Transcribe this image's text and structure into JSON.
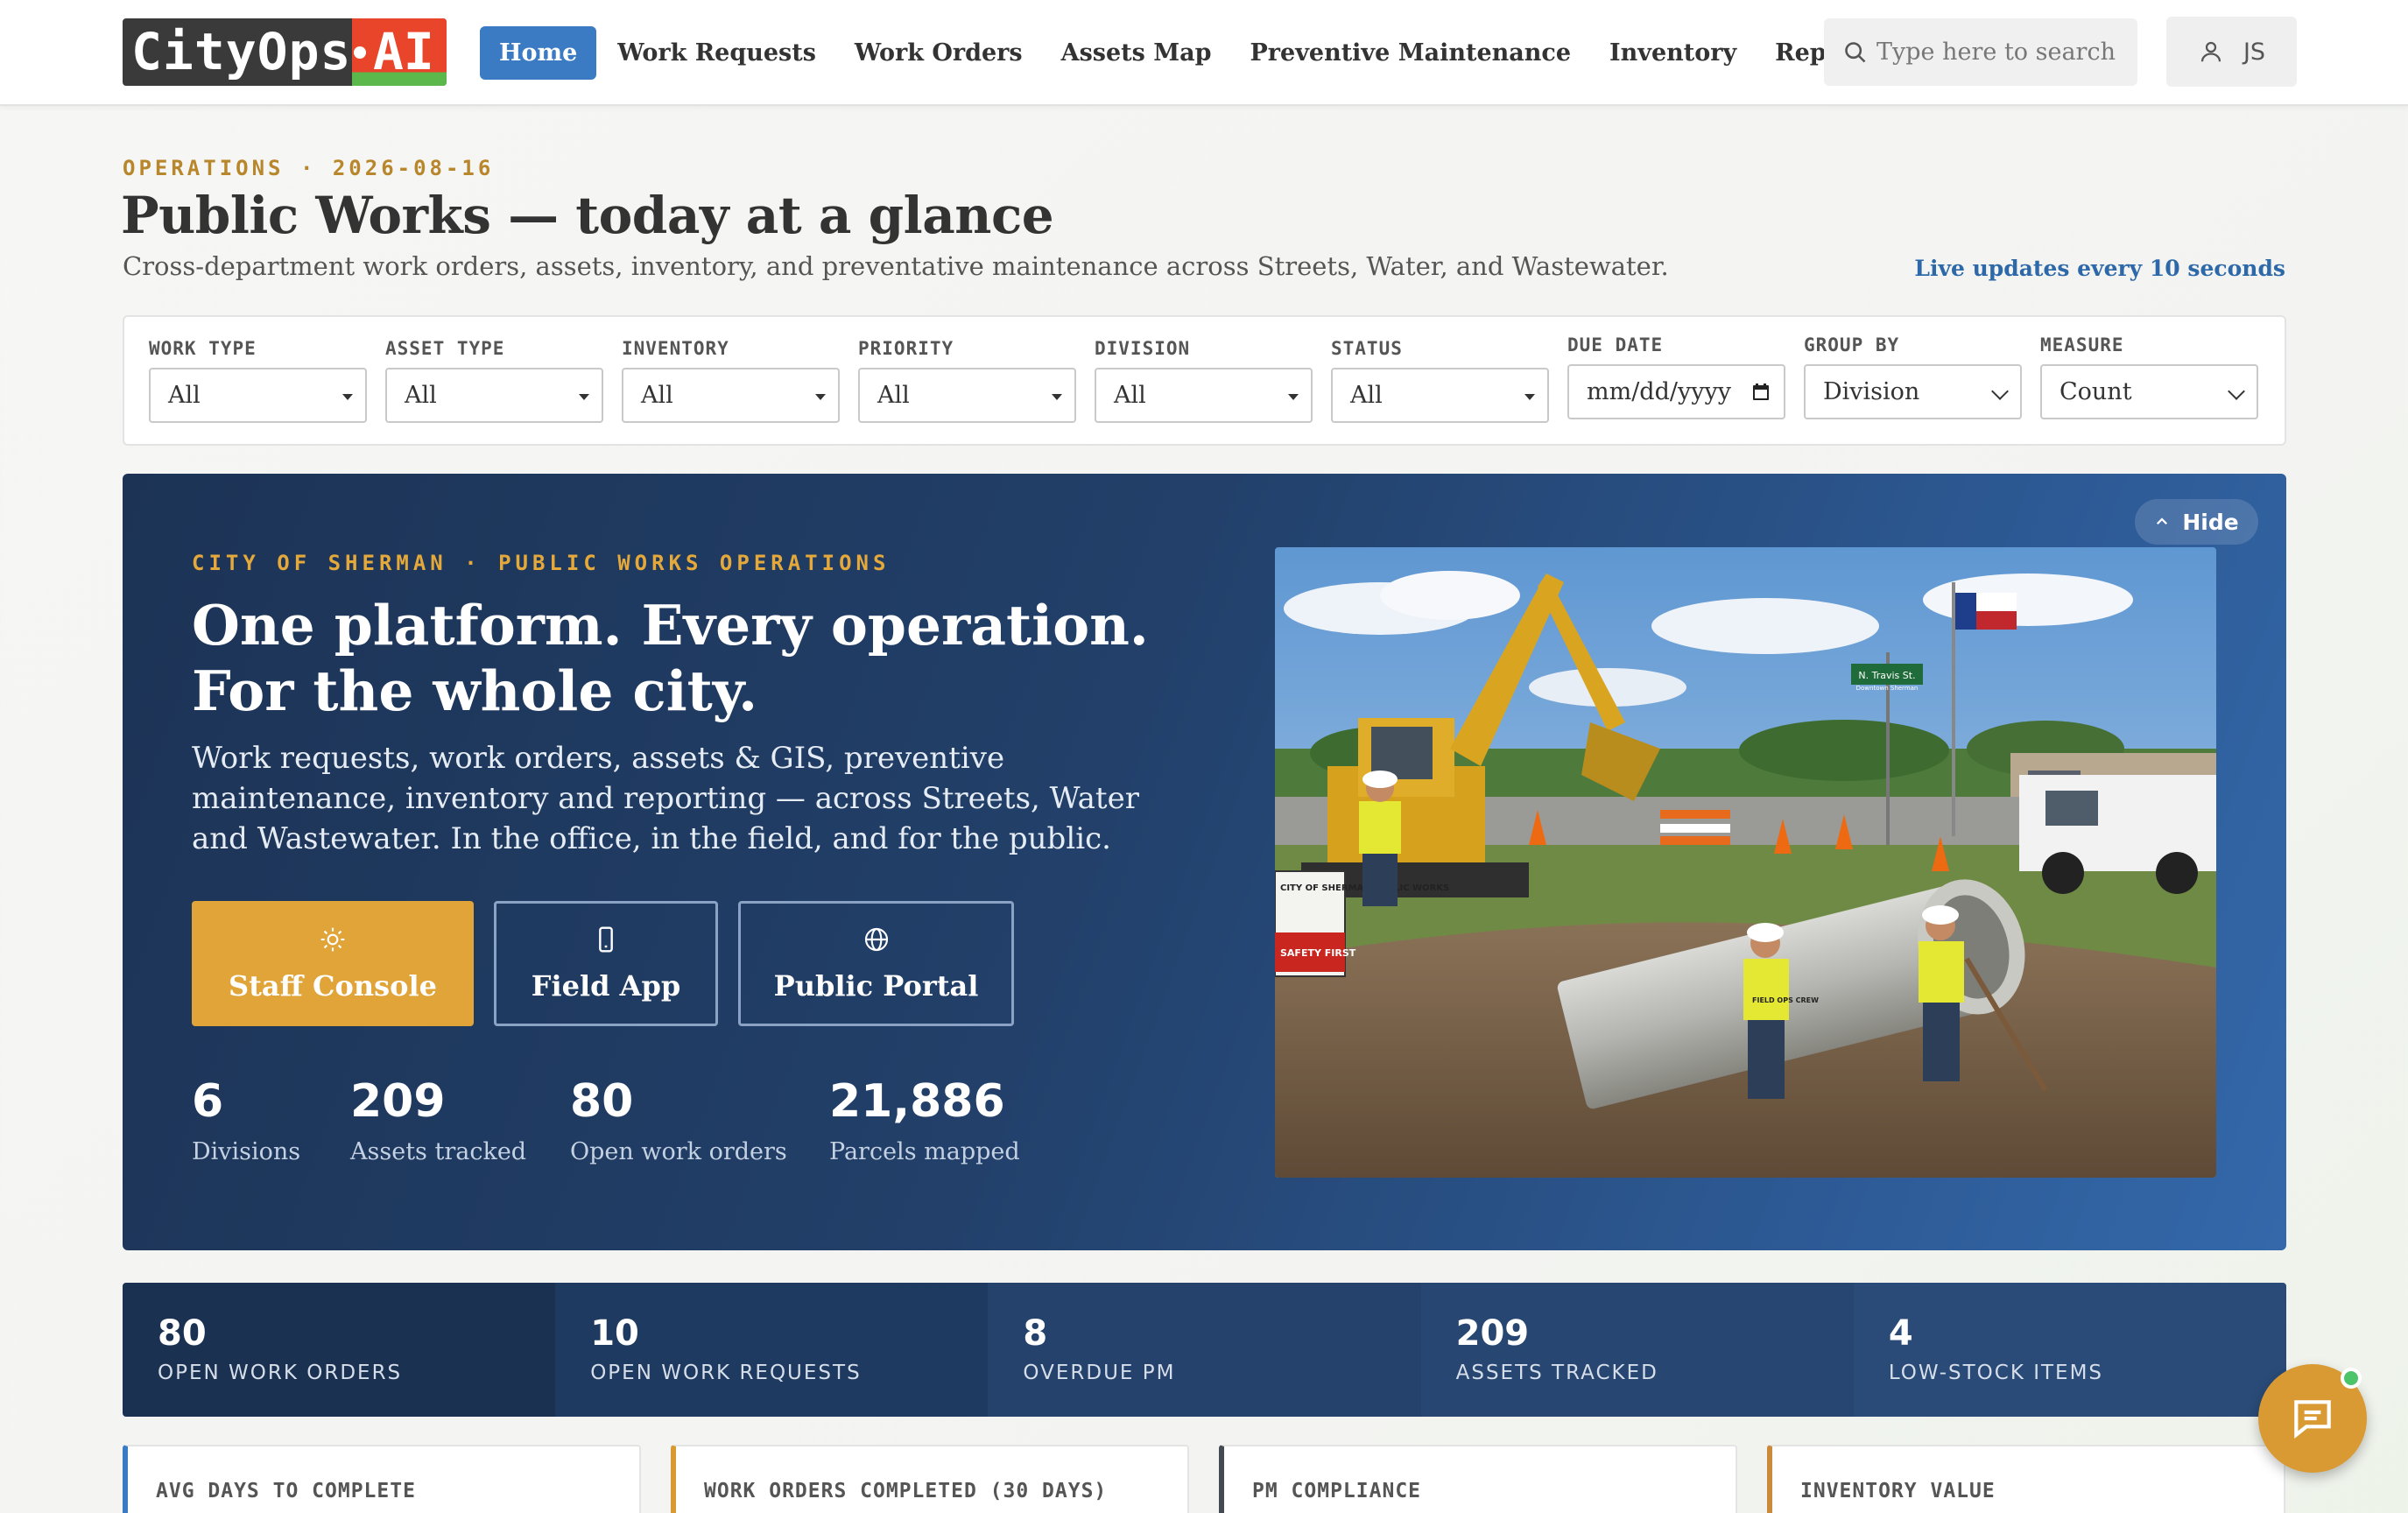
{
  "brand": {
    "name_part": "CityOps",
    "ai_part": "AI",
    "colors": {
      "primary": "#3a7bc4",
      "accent": "#e0a438",
      "navy": "#1c3355"
    }
  },
  "nav": {
    "items": [
      {
        "label": "Home",
        "active": true
      },
      {
        "label": "Work Requests",
        "active": false
      },
      {
        "label": "Work Orders",
        "active": false
      },
      {
        "label": "Assets Map",
        "active": false
      },
      {
        "label": "Preventive Maintenance",
        "active": false
      },
      {
        "label": "Inventory",
        "active": false
      },
      {
        "label": "Reports",
        "active": false
      }
    ]
  },
  "search": {
    "placeholder": "Type here to search",
    "icon": "search-icon"
  },
  "user": {
    "initials": "JS",
    "icon": "user-icon"
  },
  "header": {
    "eyebrow": "OPERATIONS · 2026-08-16",
    "title": "Public Works — today at a glance",
    "subtitle": "Cross-department work orders, assets, inventory, and preventative maintenance across Streets, Water, and Wastewater.",
    "live_note": "Live updates every 10 seconds"
  },
  "filters": [
    {
      "label": "WORK TYPE",
      "value": "All"
    },
    {
      "label": "ASSET TYPE",
      "value": "All"
    },
    {
      "label": "INVENTORY",
      "value": "All"
    },
    {
      "label": "PRIORITY",
      "value": "All"
    },
    {
      "label": "DIVISION",
      "value": "All"
    },
    {
      "label": "STATUS",
      "value": "All"
    },
    {
      "label": "DUE DATE",
      "value": "mm/dd/yyyy"
    },
    {
      "label": "GROUP BY",
      "value": "Division"
    },
    {
      "label": "MEASURE",
      "value": "Count"
    }
  ],
  "hero": {
    "kicker": "CITY OF SHERMAN · PUBLIC WORKS OPERATIONS",
    "title_line1": "One platform. Every operation.",
    "title_line2": "For the whole city.",
    "description": "Work requests, work orders, assets & GIS, preventive maintenance, inventory and reporting — across Streets, Water and Wastewater. In the office, in the field, and for the public.",
    "hide_label": "Hide",
    "buttons": [
      {
        "label": "Staff Console",
        "icon": "sun-icon"
      },
      {
        "label": "Field App",
        "icon": "phone-icon"
      },
      {
        "label": "Public Portal",
        "icon": "globe-icon"
      }
    ],
    "stats": [
      {
        "value": "6",
        "label": "Divisions"
      },
      {
        "value": "209",
        "label": "Assets tracked"
      },
      {
        "value": "80",
        "label": "Open work orders"
      },
      {
        "value": "21,886",
        "label": "Parcels mapped"
      }
    ],
    "photo": {
      "street_sign": "N. Travis St.",
      "street_sign_sub": "Downtown Sherman",
      "board_text": "CITY OF SHERMAN PUBLIC WORKS",
      "safety_text": "SAFETY FIRST",
      "vest_text": "FIELD OPS CREW"
    }
  },
  "kpis": [
    {
      "value": "80",
      "label": "OPEN WORK ORDERS",
      "bg": "#1b3152"
    },
    {
      "value": "10",
      "label": "OPEN WORK REQUESTS",
      "bg": "#1f3a60"
    },
    {
      "value": "8",
      "label": "OVERDUE PM",
      "bg": "#24426b"
    },
    {
      "value": "209",
      "label": "ASSETS TRACKED",
      "bg": "#274772"
    },
    {
      "value": "4",
      "label": "LOW-STOCK ITEMS",
      "bg": "#2a4b78"
    }
  ],
  "metric_cards": [
    {
      "title": "AVG DAYS TO COMPLETE",
      "accent": "#3a7bc4"
    },
    {
      "title": "WORK ORDERS COMPLETED (30 DAYS)",
      "accent": "#d99a33"
    },
    {
      "title": "PM COMPLIANCE",
      "accent": "#444a52"
    },
    {
      "title": "INVENTORY VALUE",
      "accent": "#c98a3b"
    }
  ],
  "chat": {
    "icon": "chat-icon",
    "status": "online"
  }
}
